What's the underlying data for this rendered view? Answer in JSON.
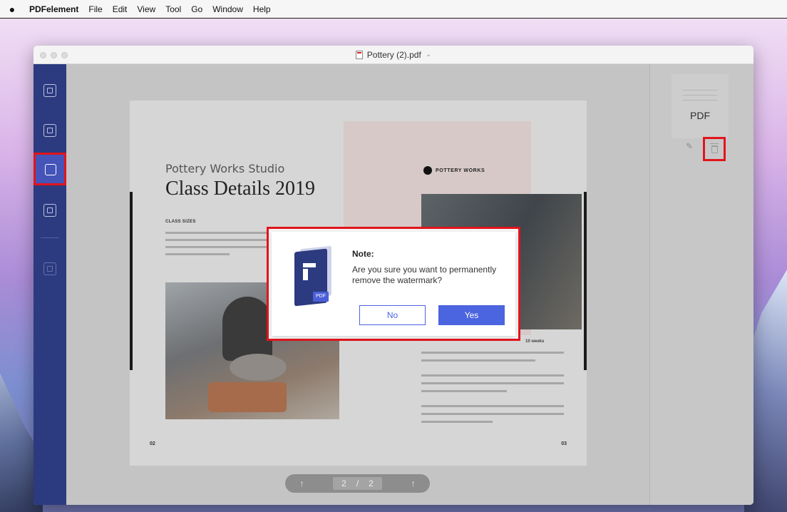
{
  "menubar": {
    "apple": "",
    "items": [
      "PDFelement",
      "File",
      "Edit",
      "View",
      "Tool",
      "Go",
      "Window",
      "Help"
    ]
  },
  "window": {
    "title": "Pottery (2).pdf",
    "chevron": "⌄"
  },
  "sidebar": {
    "icons": [
      "close-file-icon",
      "convert-icon",
      "watermark-icon",
      "page-icon",
      "edit-page-icon"
    ],
    "active": "watermark-icon"
  },
  "document": {
    "subtitle": "Pottery Works Studio",
    "heading": "Class Details 2019",
    "class_sizes": "CLASS SIZES",
    "brand": "POTTERY WORKS",
    "weeks": "10 weeks",
    "page_left": "02",
    "page_right": "03"
  },
  "pager": {
    "current": "2",
    "separator": "/",
    "total": "2"
  },
  "watermark_panel": {
    "card_label": "PDF"
  },
  "dialog": {
    "title": "Note:",
    "message": "Are you sure you want to permanently remove the watermark?",
    "no_label": "No",
    "yes_label": "Yes",
    "icon_badge": "PDF"
  },
  "colors": {
    "sidebar": "#2c3a80",
    "accent": "#4b64e0",
    "highlight": "#e2141c"
  }
}
